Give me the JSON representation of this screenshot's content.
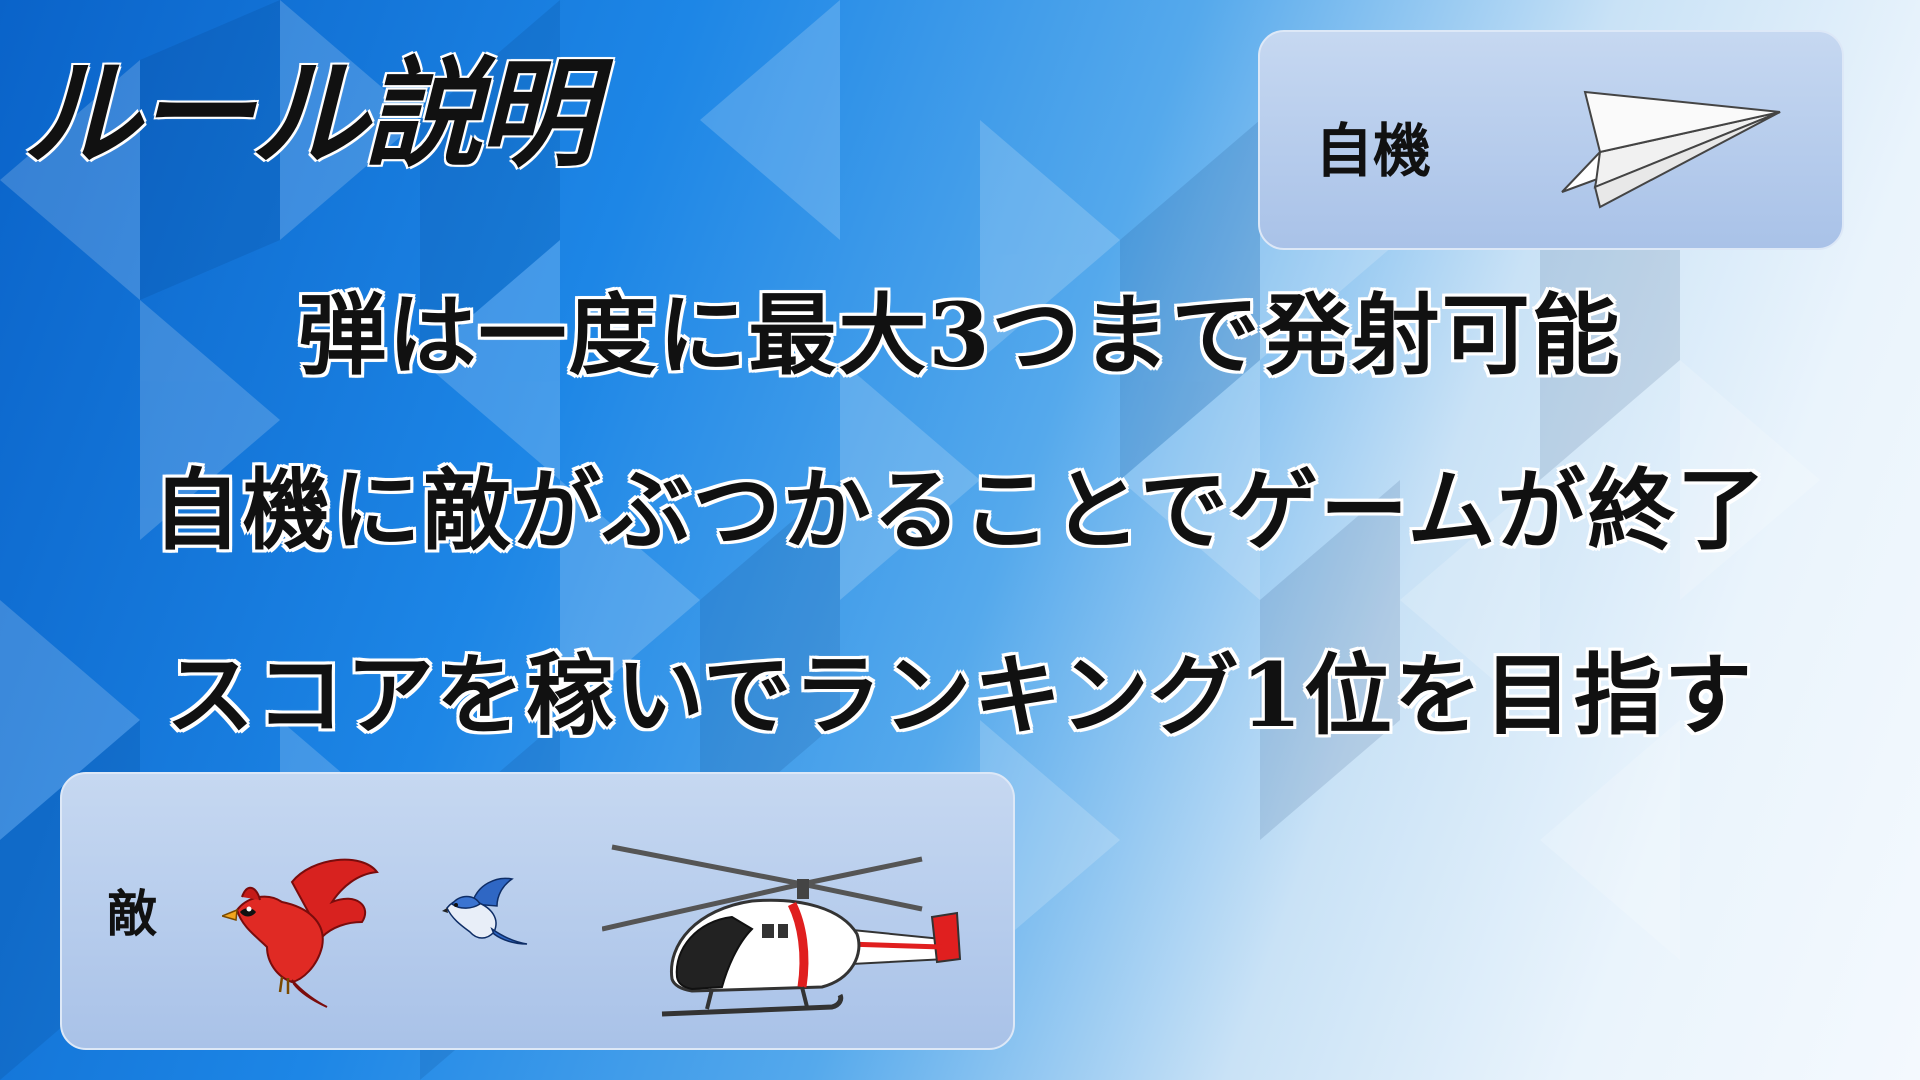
{
  "screen": {
    "title": "ルール説明"
  },
  "player_panel": {
    "label": "自機",
    "sprite_icon": "paper-airplane-icon"
  },
  "rules": [
    "弾は一度に最大3つまで発射可能",
    "自機に敵がぶつかることでゲームが終了",
    "スコアを稼いでランキング1位を目指す"
  ],
  "enemy_panel": {
    "label": "敵",
    "sprites": [
      "cardinal-bird-icon",
      "blue-jay-icon",
      "helicopter-icon"
    ]
  },
  "colors": {
    "bg_dark": "#0a63c9",
    "bg_light": "#f4f9fe",
    "panel": "#b7cdec",
    "text": "#111111",
    "cardinal_red": "#d8221f",
    "helicopter_red": "#e01f1f"
  }
}
